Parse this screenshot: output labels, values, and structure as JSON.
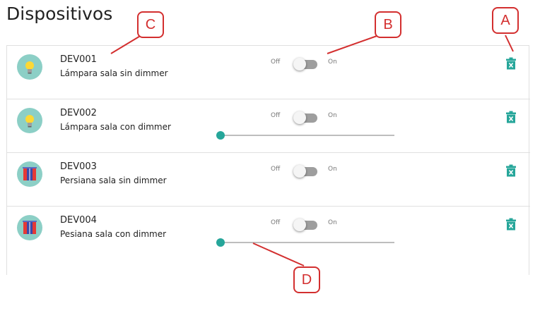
{
  "page": {
    "title": "Dispositivos"
  },
  "switch_labels": {
    "off": "Off",
    "on": "On"
  },
  "colors": {
    "accent": "#26a69a",
    "avatar_bg": "#8ccfc6",
    "annotation": "#d32f2f"
  },
  "devices": [
    {
      "id": "DEV001",
      "description": "Lámpara sala sin dimmer",
      "icon": "lightbulb-icon",
      "switch_on": false,
      "has_dimmer": false
    },
    {
      "id": "DEV002",
      "description": "Lámpara sala con dimmer",
      "icon": "lightbulb-icon",
      "switch_on": false,
      "has_dimmer": true,
      "dimmer_value": 0
    },
    {
      "id": "DEV003",
      "description": "Persiana sala sin dimmer",
      "icon": "window-blind-icon",
      "switch_on": false,
      "has_dimmer": false
    },
    {
      "id": "DEV004",
      "description": "Pesiana sala con dimmer",
      "icon": "window-blind-icon",
      "switch_on": false,
      "has_dimmer": true,
      "dimmer_value": 0
    }
  ],
  "annotations": {
    "a": "A",
    "b": "B",
    "c": "C",
    "d": "D"
  }
}
